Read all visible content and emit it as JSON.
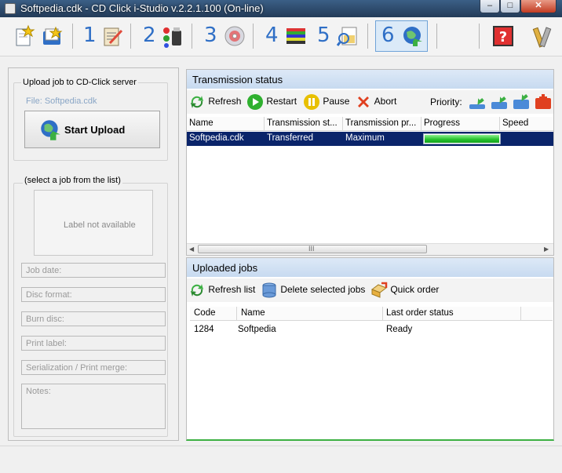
{
  "window": {
    "title": "Softpedia.cdk - CD Click i-Studio v.2.2.1.100 (On-line)",
    "minimize_glyph": "–",
    "maximize_glyph": "□",
    "close_glyph": "✕"
  },
  "toolbar": {
    "steps": [
      "1",
      "2",
      "3",
      "4",
      "5",
      "6"
    ],
    "icons": [
      "new-project-icon",
      "open-project-icon",
      "job-edit-icon",
      "paint-palette-icon",
      "disc-burn-icon",
      "disc-stack-icon",
      "print-preview-icon",
      "upload-globe-icon",
      "help-icon",
      "tools-icon"
    ]
  },
  "upload": {
    "legend": "Upload job to CD-Click server",
    "file_info": "File: Softpedia.cdk",
    "start_label": "Start Upload"
  },
  "job": {
    "legend": "(select a job from the list)",
    "label_placeholder": "Label not available",
    "fields": {
      "job_date": "Job date:",
      "disc_format": "Disc format:",
      "burn_disc": "Burn disc:",
      "print_label": "Print label:",
      "serialization": "Serialization / Print merge:",
      "notes": "Notes:"
    }
  },
  "transmission": {
    "title": "Transmission status",
    "buttons": {
      "refresh": "Refresh",
      "restart": "Restart",
      "pause": "Pause",
      "abort": "Abort",
      "priority": "Priority:"
    },
    "columns": {
      "name": "Name",
      "status": "Transmission st...",
      "priority": "Transmission pr...",
      "progress": "Progress",
      "speed": "Speed"
    },
    "rows": [
      {
        "name": "Softpedia.cdk",
        "status": "Transferred",
        "priority": "Maximum",
        "progress": 1.0,
        "speed": ""
      }
    ],
    "scroll_grip": "III"
  },
  "uploaded": {
    "title": "Uploaded jobs",
    "buttons": {
      "refresh_list": "Refresh list",
      "delete_selected": "Delete selected jobs",
      "quick_order": "Quick order"
    },
    "columns": {
      "code": "Code",
      "name": "Name",
      "last_status": "Last order status"
    },
    "rows": [
      {
        "code": "1284",
        "name": "Softpedia",
        "last_status": "Ready"
      }
    ]
  },
  "colors": {
    "title_bar": "#2d4a6b",
    "accent_blue": "#2f6fc6",
    "selection": "#0a246a",
    "progress_green": "#22c02a",
    "panel_header": "#c7daf0"
  }
}
